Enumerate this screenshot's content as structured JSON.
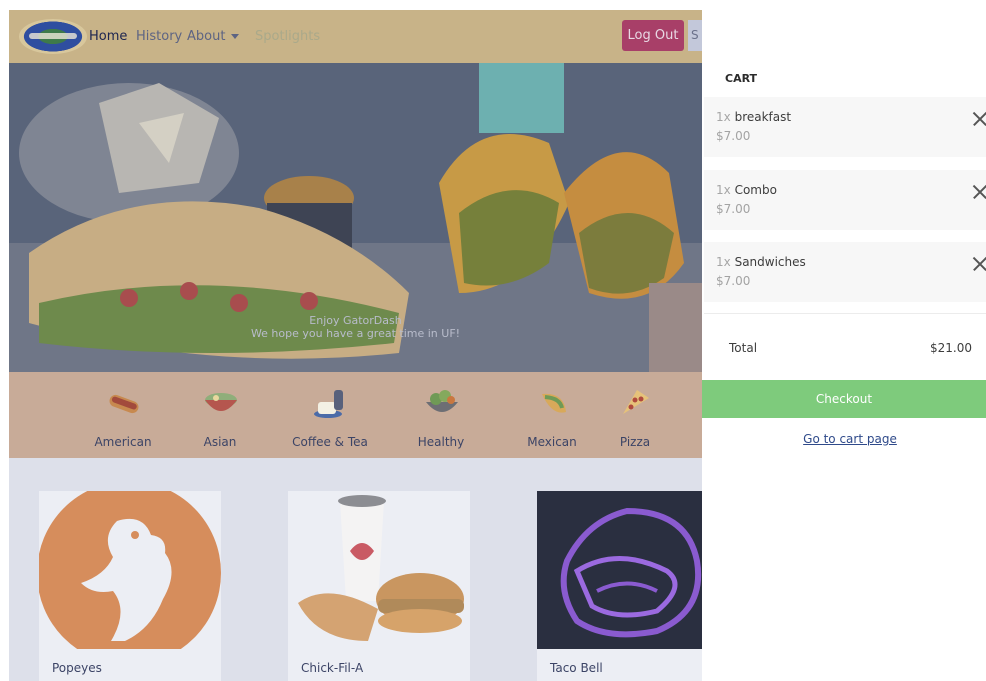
{
  "navbar": {
    "links": [
      {
        "label": "Home"
      },
      {
        "label": "History"
      },
      {
        "label": "About"
      },
      {
        "label": "Spotlights"
      }
    ],
    "logout_label": "Log Out",
    "cut_button_label": "S",
    "logo_icon": "gator-logo-icon"
  },
  "hero": {
    "caption_title": "Enjoy GatorDash",
    "caption_text": "We hope you have a great time in UF!"
  },
  "categories": [
    {
      "label": "American",
      "icon": "hotdog-icon"
    },
    {
      "label": "Asian",
      "icon": "bowl-icon"
    },
    {
      "label": "Coffee & Tea",
      "icon": "coffee-icon"
    },
    {
      "label": "Healthy",
      "icon": "salad-icon"
    },
    {
      "label": "Mexican",
      "icon": "taco-icon"
    },
    {
      "label": "Pizza",
      "icon": "pizza-icon"
    }
  ],
  "restaurants": [
    {
      "name": "Popeyes"
    },
    {
      "name": "Chick-Fil-A"
    },
    {
      "name": "Taco Bell"
    }
  ],
  "cart": {
    "title": "CART",
    "items": [
      {
        "qty": "1x",
        "name": "breakfast",
        "price": "$7.00"
      },
      {
        "qty": "1x",
        "name": "Combo",
        "price": "$7.00"
      },
      {
        "qty": "1x",
        "name": "Sandwiches",
        "price": "$7.00"
      }
    ],
    "total_label": "Total",
    "total_value": "$21.00",
    "checkout_label": "Checkout",
    "cart_page_link": "Go to cart page"
  },
  "colors": {
    "navbar": "#c8b388",
    "logout": "#a83f68",
    "checkout": "#7ecb7c",
    "overlay": "#dde0ea"
  }
}
